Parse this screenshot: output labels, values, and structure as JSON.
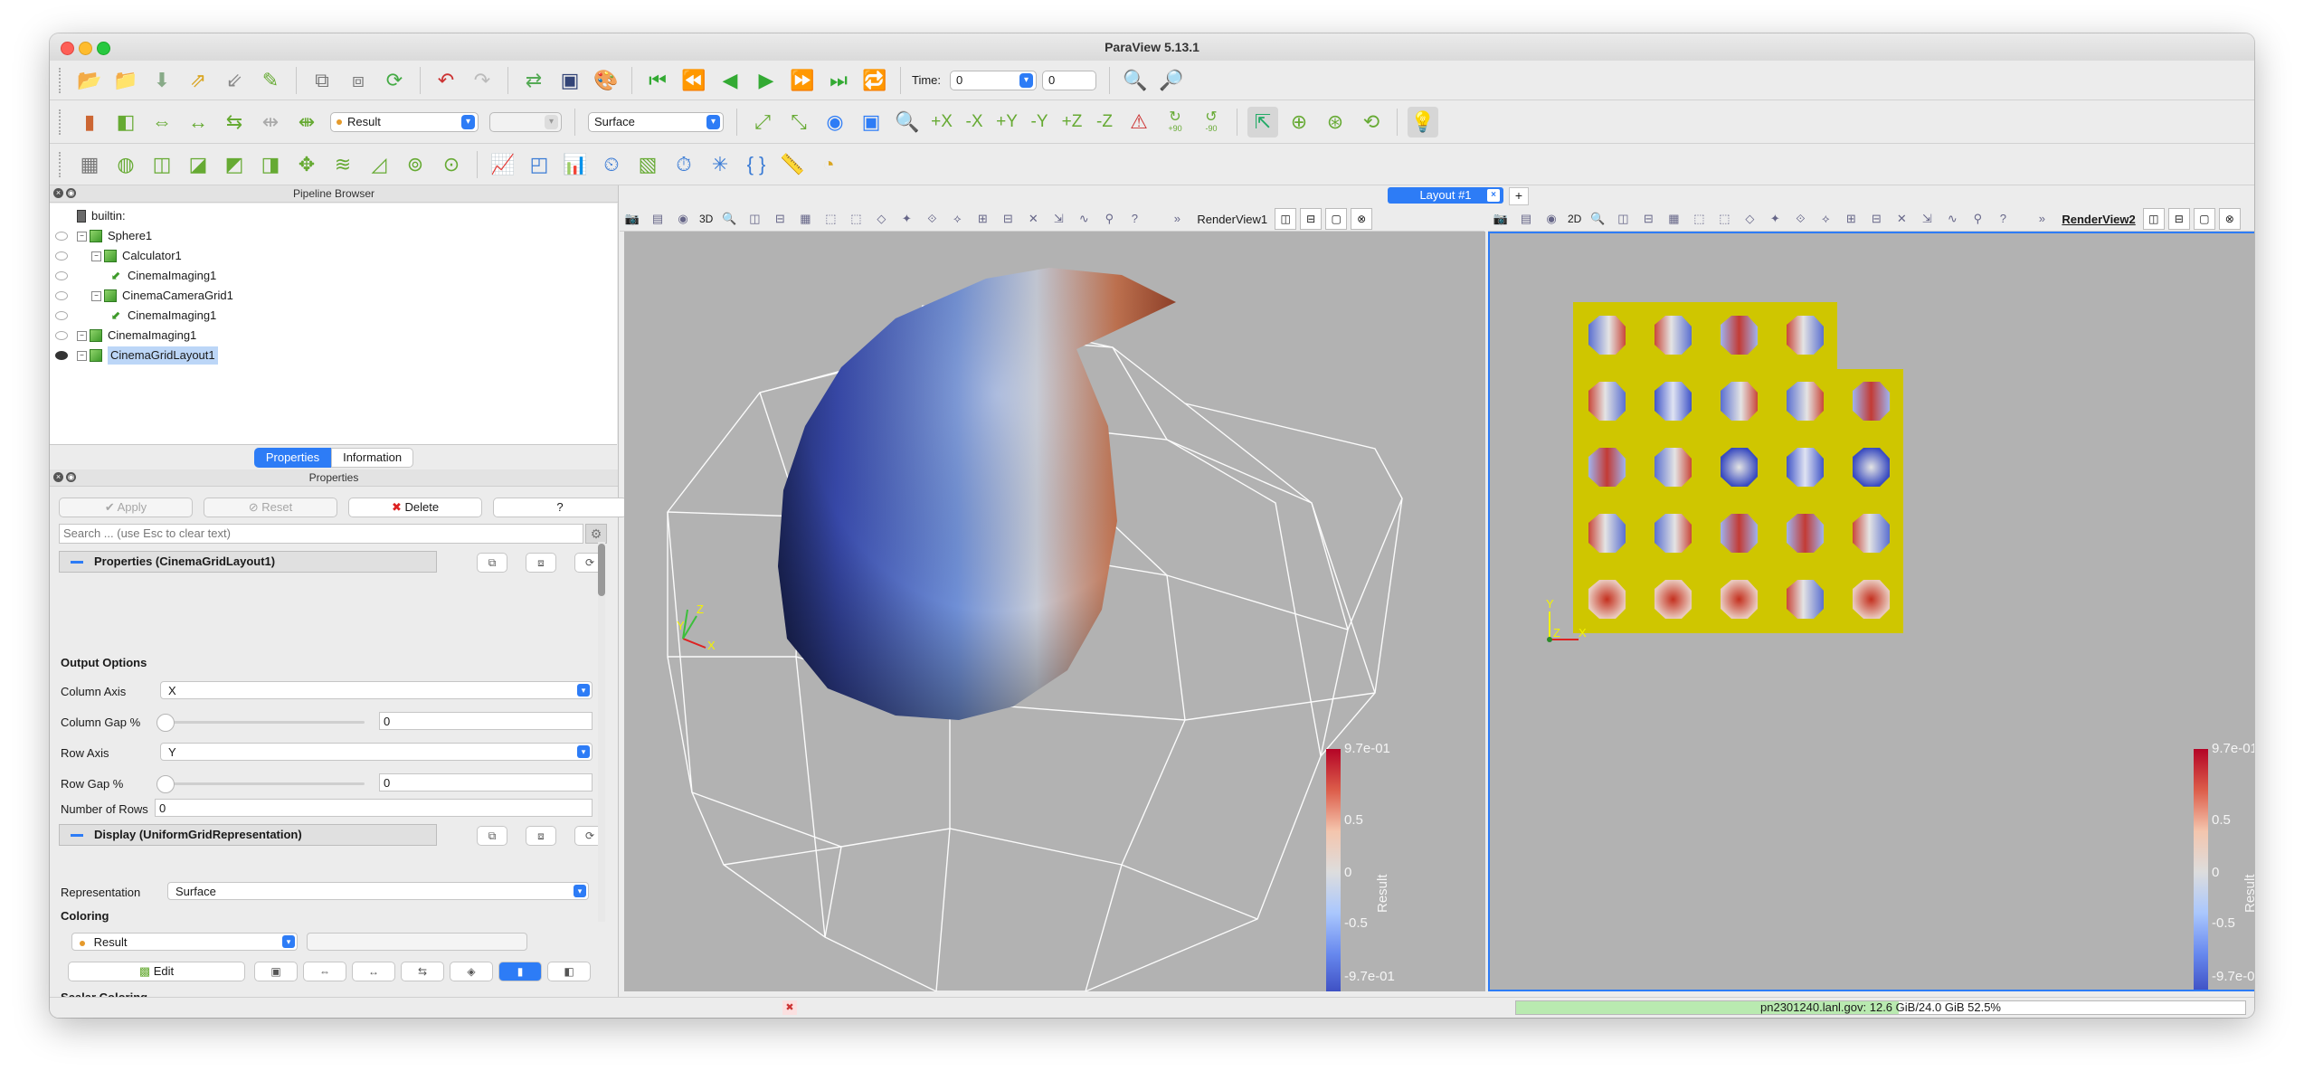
{
  "window": {
    "title": "ParaView 5.13.1"
  },
  "toolbar1": {
    "time_label": "Time:",
    "time_value": "0",
    "time_index": "0"
  },
  "toolbar2": {
    "color_by": "Result",
    "component": "",
    "representation": "Surface",
    "rotate_plus": "+90",
    "rotate_minus": "-90"
  },
  "pipeline": {
    "title": "Pipeline Browser",
    "items": [
      {
        "label": "builtin:"
      },
      {
        "label": "Sphere1"
      },
      {
        "label": "Calculator1"
      },
      {
        "label": "CinemaImaging1"
      },
      {
        "label": "CinemaCameraGrid1"
      },
      {
        "label": "CinemaImaging1"
      },
      {
        "label": "CinemaImaging1"
      },
      {
        "label": "CinemaGridLayout1"
      }
    ]
  },
  "tabs": {
    "properties": "Properties",
    "information": "Information"
  },
  "properties": {
    "title": "Properties",
    "apply": "Apply",
    "reset": "Reset",
    "delete": "Delete",
    "help": "?",
    "search_placeholder": "Search ... (use Esc to clear text)",
    "section_props": "Properties (CinemaGridLayout1)",
    "output_options": "Output Options",
    "column_axis_label": "Column Axis",
    "column_axis_value": "X",
    "column_gap_label": "Column Gap %",
    "column_gap_value": "0",
    "row_axis_label": "Row Axis",
    "row_axis_value": "Y",
    "row_gap_label": "Row Gap %",
    "row_gap_value": "0",
    "num_rows_label": "Number of Rows",
    "num_rows_value": "0",
    "section_display": "Display (UniformGridRepresentation)",
    "representation_label": "Representation",
    "representation_value": "Surface",
    "coloring_label": "Coloring",
    "coloring_value": "Result",
    "edit_label": "Edit",
    "scalar_coloring": "Scalar Coloring"
  },
  "layout": {
    "tab": "Layout #1",
    "add": "+"
  },
  "view1": {
    "name": "RenderView1",
    "mode": "3D"
  },
  "view2": {
    "name": "RenderView2",
    "mode": "2D"
  },
  "colorbar": {
    "title": "Result",
    "max": "9.7e-01",
    "v1": "0.5",
    "v2": "0",
    "v3": "-0.5",
    "min": "-9.7e-01"
  },
  "axes": {
    "x": "X",
    "y": "Y",
    "z": "Z"
  },
  "status": {
    "memory": "pn2301240.lanl.gov: 12.6 GiB/24.0 GiB 52.5%",
    "memory_fraction": 0.525
  },
  "colors": {
    "accent": "#2d7cf6",
    "background": "#b2b2b2",
    "grid_bg": "#cfc600"
  }
}
